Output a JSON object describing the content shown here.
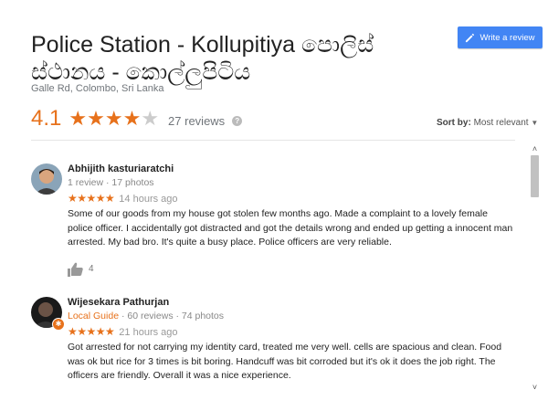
{
  "place": {
    "title": "Police Station - Kollupitiya පොලිස් ස්ථානය - කොල්ලුපිටිය",
    "address": "Galle Rd, Colombo, Sri Lanka",
    "rating": "4.1",
    "stars_value": 4.1,
    "reviews_count": "27 reviews"
  },
  "toolbar": {
    "write_review_label": "Write a review",
    "help_glyph": "?"
  },
  "sort": {
    "label": "Sort by:",
    "value": "Most relevant"
  },
  "reviews": [
    {
      "name": "Abhijith kasturiaratchi",
      "meta": "1 review · 17 photos",
      "stars": "★★★★★",
      "time": "14 hours ago",
      "text": "Some of our goods from my house got stolen few months ago. Made a complaint to a lovely female police officer. I accidentally got distracted and got the details wrong and ended up getting a innocent man arrested. My bad bro. It's quite a busy place. Police officers are very reliable.",
      "likes": "4"
    },
    {
      "name": "Wijesekara Pathurjan",
      "guide_label": "Local Guide",
      "meta": " · 60 reviews · 74 photos",
      "stars": "★★★★★",
      "time": "21 hours ago",
      "text": "Got arrested for not carrying my identity card, treated me very well. cells are spacious and clean. Food was ok but rice for 3 times is bit boring. Handcuff was bit corroded but it's ok it does the job right. The officers are friendly. Overall it was a nice experience."
    }
  ],
  "colors": {
    "accent": "#e7711b",
    "button": "#4285f4"
  }
}
